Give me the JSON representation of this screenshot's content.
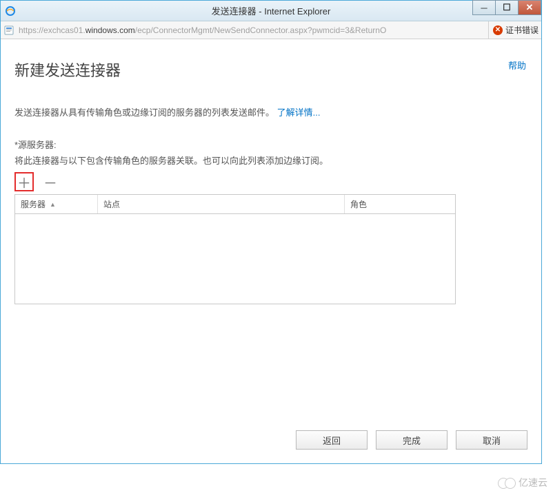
{
  "window": {
    "title": "发送连接器 - Internet Explorer"
  },
  "addressbar": {
    "url_prefix": "https://exchcas01.",
    "url_host": "windows.com",
    "url_suffix": "/ecp/ConnectorMgmt/NewSendConnector.aspx?pwmcid=3&ReturnO",
    "cert_error": "证书错误"
  },
  "page": {
    "help": "帮助",
    "heading": "新建发送连接器",
    "desc_text": "发送连接器从具有传输角色或边缘订阅的服务器的列表发送邮件。",
    "desc_link": "了解详情...",
    "source_label": "*源服务器:",
    "source_help": "将此连接器与以下包含传输角色的服务器关联。也可以向此列表添加边缘订阅。"
  },
  "toolbar": {
    "add": "＋",
    "remove": "－"
  },
  "table": {
    "columns": {
      "server": "服务器",
      "site": "站点",
      "role": "角色"
    },
    "rows": []
  },
  "buttons": {
    "back": "返回",
    "finish": "完成",
    "cancel": "取消"
  },
  "watermark": "亿速云"
}
